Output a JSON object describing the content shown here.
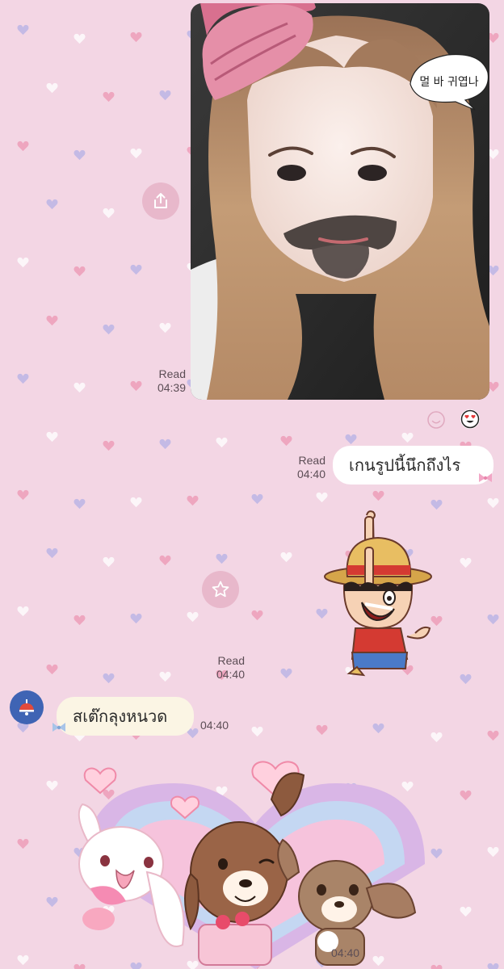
{
  "messages": {
    "photo": {
      "read_label": "Read",
      "time": "04:39",
      "overlay_text": "멀 바 귀엽나"
    },
    "text_out": {
      "text": "เกนรูปนี้นึกถึงไร",
      "read_label": "Read",
      "time": "04:40"
    },
    "sticker_out": {
      "read_label": "Read",
      "time": "04:40"
    },
    "text_in": {
      "text": "สเต๊กลุงหนวด",
      "time": "04:40"
    },
    "sticker_in": {
      "time": "04:40"
    }
  },
  "icons": {
    "share": "share-icon",
    "favorite": "star-icon",
    "add_reaction": "smiley-outline-icon",
    "reaction": "heart-eyes-emoji-icon",
    "avatar": "lamp-icon"
  },
  "colors": {
    "background": "#f3d6e4",
    "outgoing_bubble": "#ffffff",
    "incoming_bubble": "#fbf5e4",
    "action_button": "#e8b8cb"
  }
}
